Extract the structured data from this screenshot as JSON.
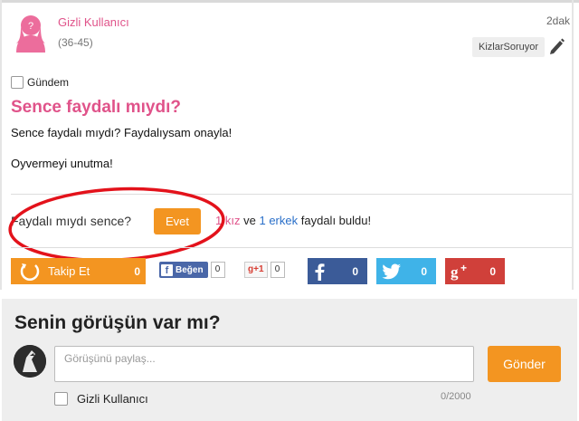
{
  "post": {
    "author_name": "Gizli Kullanıcı",
    "author_age": "(36-45)",
    "time_ago": "2dak",
    "source_tag": "KizlarSoruyor",
    "topic_label": "Gündem",
    "title": "Sence faydalı mıydı?",
    "body_line1": "Sence faydalı mıydı? Faydalıysam onayla!",
    "body_line2": "Oyvermeyi unutma!"
  },
  "helpful": {
    "question": "Faydalı mıydı sence?",
    "yes_label": "Evet",
    "girl_count": "1",
    "girl_word": "kız",
    "and_word": "ve",
    "boy_count": "1",
    "boy_word": "erkek",
    "suffix": "faydalı buldu!"
  },
  "social": {
    "follow_label": "Takip Et",
    "follow_count": "0",
    "fb_like_label": "Beğen",
    "fb_like_count": "0",
    "gplus_label": "g+1",
    "gplus_count": "0",
    "share_fb_count": "0",
    "share_tw_count": "0",
    "share_gp_count": "0"
  },
  "comment": {
    "heading": "Senin görüşün var mı?",
    "placeholder": "Görüşünü paylaş...",
    "send_label": "Gönder",
    "anonymous_label": "Gizli Kullanıcı",
    "char_counter": "0/2000"
  },
  "colors": {
    "accent_pink": "#e0538a",
    "accent_orange": "#f39521",
    "facebook": "#3b5b98",
    "twitter": "#3fb3e8",
    "googleplus": "#d0403a",
    "annotation_red": "#e3121b"
  },
  "icons": [
    "female-avatar-icon",
    "pencil-icon",
    "follow-refresh-icon",
    "facebook-icon",
    "twitter-icon",
    "google-plus-icon"
  ]
}
